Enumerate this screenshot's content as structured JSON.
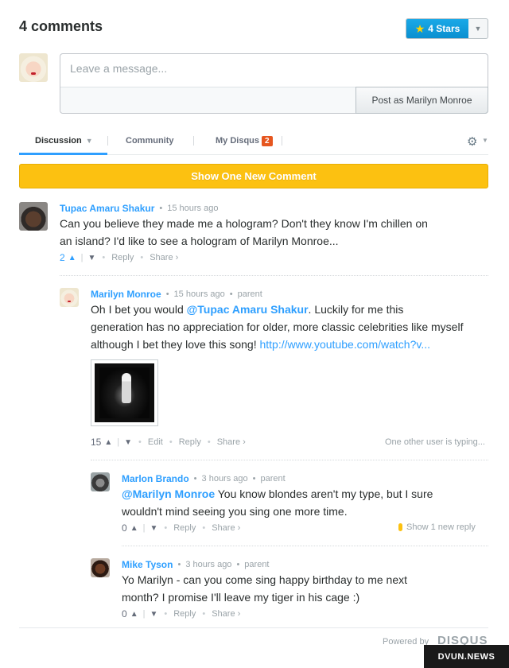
{
  "header": {
    "comment_count": "4 comments",
    "stars_label": "4 Stars",
    "stars_icon": "star-icon"
  },
  "composer": {
    "placeholder": "Leave a message...",
    "post_button": "Post as Marilyn Monroe"
  },
  "tabs": [
    {
      "label": "Discussion",
      "active": true
    },
    {
      "label": "Community",
      "active": false
    },
    {
      "label": "My Disqus",
      "badge": "2",
      "active": false
    }
  ],
  "new_comment_bar": "Show One New Comment",
  "comments": [
    {
      "author": "Tupac Amaru Shakur",
      "time": "15 hours ago",
      "line1": "Can you believe they made me a hologram? Don't they know I'm chillen on",
      "line2": "an island? I'd like to see a hologram of Marilyn Monroe...",
      "votes": "2",
      "reply": "Reply",
      "share": "Share ›"
    },
    {
      "author": "Marilyn Monroe",
      "time": "15 hours ago",
      "parent": "parent",
      "mention": "@Tupac Amaru Shakur",
      "line1_rest": ". Luckily for me this",
      "line1_start": "Oh I bet you would ",
      "line2": "generation has no appreciation for older, more classic celebrities like myself",
      "line3_start": "although I bet they love this song! ",
      "link": "http://www.youtube.com/watch?v...",
      "votes": "15",
      "edit": "Edit",
      "reply": "Reply",
      "share": "Share ›",
      "typing": "One other user is typing..."
    },
    {
      "author": "Marlon Brando",
      "time": "3 hours ago",
      "parent": "parent",
      "mention": "@Marilyn Monroe",
      "line1_rest": " You know blondes aren't my type, but I sure",
      "line2": "wouldn't mind seeing you sing one more time.",
      "votes": "0",
      "reply": "Reply",
      "share": "Share ›",
      "new_reply": "Show 1 new reply"
    },
    {
      "author": "Mike Tyson",
      "time": "3 hours ago",
      "parent": "parent",
      "line1": "Yo Marilyn - can you come sing happy birthday to me next",
      "line2": "month? I promise I'll leave my tiger in his cage :)",
      "votes": "0",
      "reply": "Reply",
      "share": "Share ›"
    }
  ],
  "footer": {
    "powered_by": "Powered by",
    "logo": "DISQUS",
    "watermark": "DVUN.NEWS"
  },
  "colors": {
    "accent": "#2e9fff",
    "new_bar": "#fcc111",
    "badge": "#e6561f"
  }
}
